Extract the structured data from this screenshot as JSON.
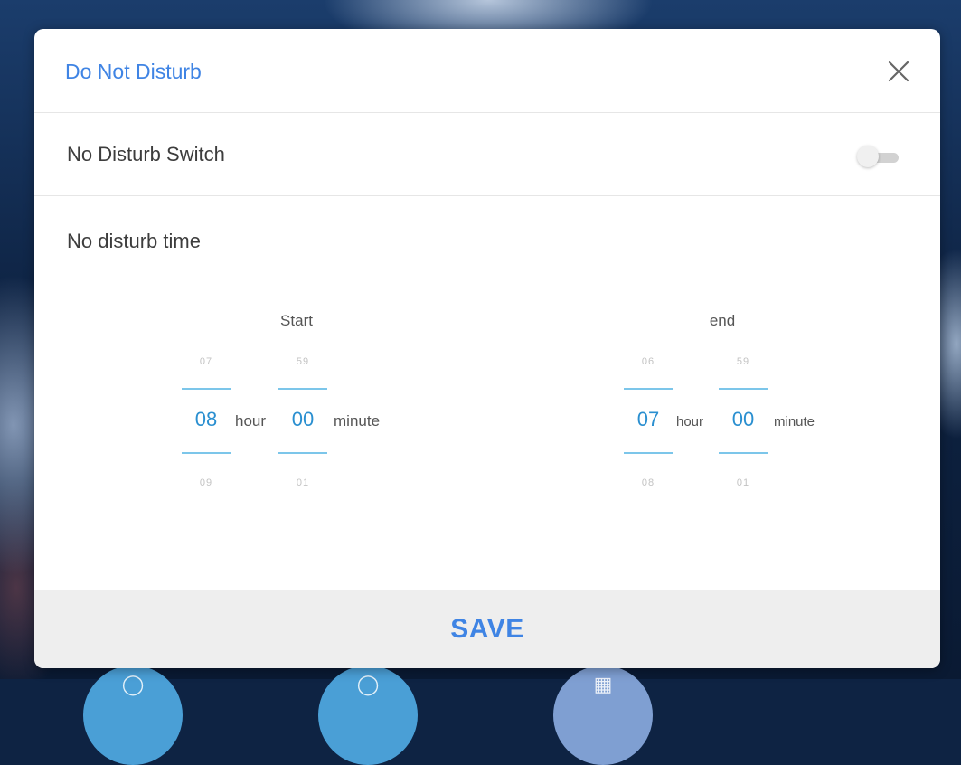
{
  "dialog": {
    "title": "Do Not Disturb",
    "close_icon": "close-icon"
  },
  "switch_row": {
    "label": "No Disturb Switch",
    "enabled": false
  },
  "time_section": {
    "label": "No disturb time",
    "start": {
      "heading": "Start",
      "hour": {
        "prev": "07",
        "value": "08",
        "next": "09"
      },
      "hour_unit": "hour",
      "minute": {
        "prev": "59",
        "value": "00",
        "next": "01"
      },
      "minute_unit": "minute"
    },
    "end": {
      "heading": "end",
      "hour": {
        "prev": "06",
        "value": "07",
        "next": "08"
      },
      "hour_unit": "hour",
      "minute": {
        "prev": "59",
        "value": "00",
        "next": "01"
      },
      "minute_unit": "minute"
    }
  },
  "footer": {
    "save_label": "SAVE"
  },
  "colors": {
    "accent": "#3f84e4",
    "wheel_value": "#2a8fd0",
    "wheel_line": "#7cc6ea"
  }
}
